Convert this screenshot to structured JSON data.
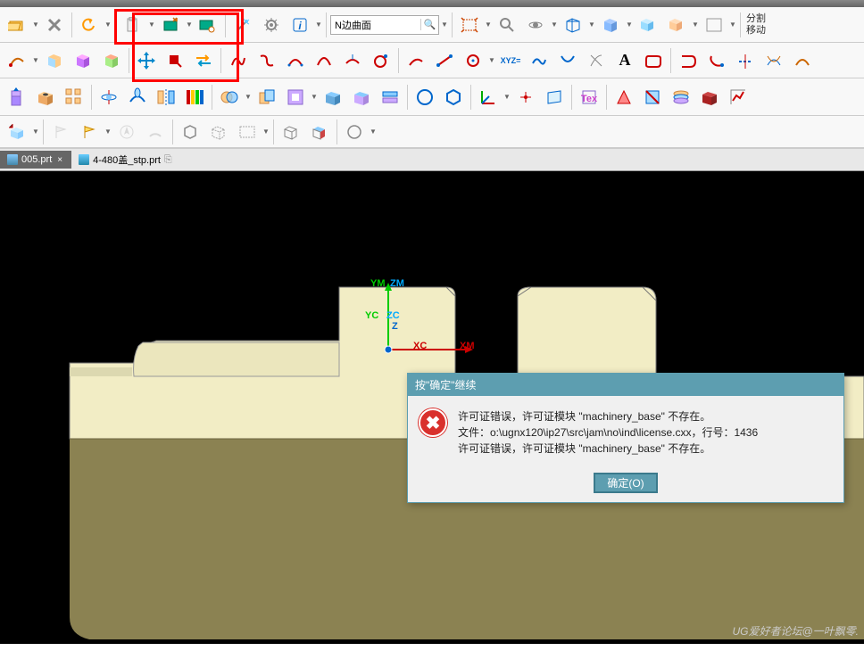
{
  "menubar": "menu",
  "search": {
    "value": "N边曲面",
    "placeholder": ""
  },
  "right_button": {
    "line1": "分割",
    "line2": "移动"
  },
  "tabs": {
    "active": {
      "label": "005.prt",
      "close": "×",
      "pinned": "✕"
    },
    "inactive": {
      "label": "4-480盖_stp.prt",
      "marker": "⎘"
    }
  },
  "axes": {
    "ym": "YM",
    "zm": "ZM",
    "yc": "YC",
    "zc": "ZC",
    "z": "Z",
    "xc": "XC",
    "xm": "XM"
  },
  "dialog": {
    "title": "按\"确定\"继续",
    "line1": "许可证错误，许可证模块 \"machinery_base\" 不存在。",
    "line2": "文件：o:\\ugnx120\\ip27\\src\\jam\\no\\ind\\license.cxx，行号：1436",
    "line3": "许可证错误，许可证模块 \"machinery_base\" 不存在。",
    "ok": "确定(O)"
  },
  "watermark": "UG爱好者论坛@一叶飘零.",
  "icons": {
    "search": "🔍"
  }
}
